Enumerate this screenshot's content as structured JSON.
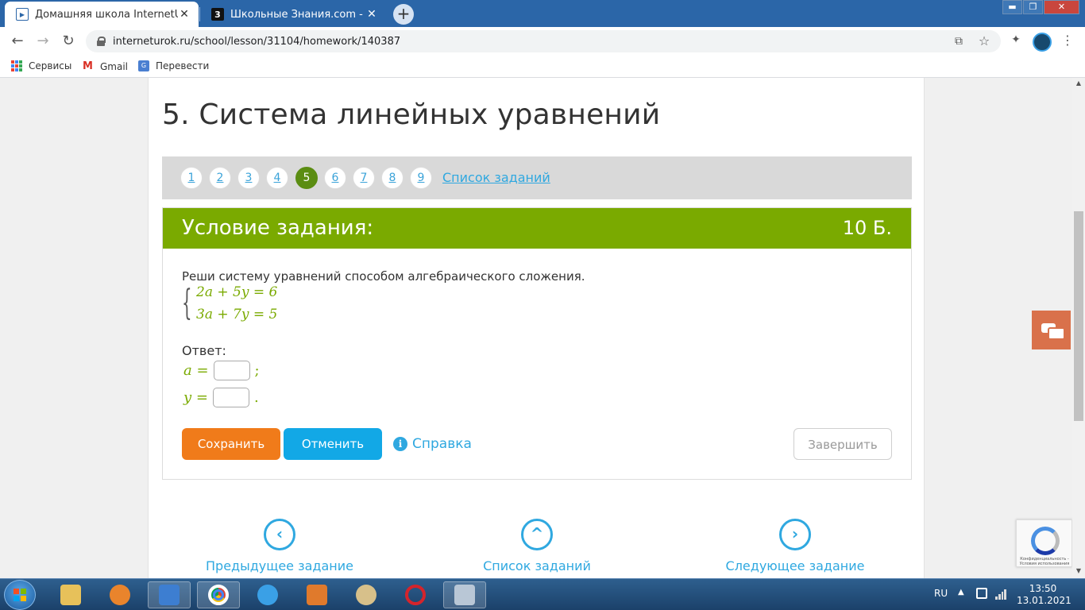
{
  "browser": {
    "tabs": [
      {
        "title": "Домашняя школа InternetUrok.ru",
        "close": "✕",
        "favicon": "play-icon"
      },
      {
        "title": "Школьные Знания.com - Решаем",
        "close": "✕",
        "favicon": "znanija-icon",
        "favicon_letter": "3"
      }
    ],
    "new_tab": "+",
    "window_controls": {
      "minimize": "▬",
      "maximize": "❐",
      "close": "✕"
    },
    "url": "interneturok.ru/school/lesson/31104/homework/140387",
    "bookmarks": [
      {
        "label": "Сервисы",
        "icon": "apps-icon"
      },
      {
        "label": "Gmail",
        "icon": "gmail-icon"
      },
      {
        "label": "Перевести",
        "icon": "translate-icon"
      }
    ],
    "gmail_glyph": "M",
    "translate_glyph": "G",
    "nav_glyphs": {
      "back": "←",
      "forward": "→",
      "reload": "↻",
      "open": "⧉",
      "star": "☆",
      "ext": "✦",
      "menu": "⋮"
    }
  },
  "lesson": {
    "title": "5. Система линейных уравнений",
    "pagination": [
      "1",
      "2",
      "3",
      "4",
      "5",
      "6",
      "7",
      "8",
      "9"
    ],
    "active_page": "5",
    "task_list_link": "Список заданий"
  },
  "task": {
    "heading": "Условие задания:",
    "points": "10 Б.",
    "text": "Реши систему уравнений способом алгебраического сложения.",
    "brace": "{",
    "equations": [
      "2a + 5y = 6",
      "3a + 7y = 5"
    ],
    "answer_label": "Ответ:",
    "answers": [
      {
        "var": "a =",
        "punct": ";",
        "value": ""
      },
      {
        "var": "y =",
        "punct": ".",
        "value": ""
      }
    ],
    "buttons": {
      "save": "Сохранить",
      "cancel": "Отменить",
      "help": "Справка",
      "finish": "Завершить"
    },
    "info_glyph": "i"
  },
  "bottom_nav": {
    "prev": "Предыдущее задание",
    "list": "Список заданий",
    "next": "Следующее задание",
    "prev_glyph": "‹",
    "list_glyph": "^",
    "next_glyph": "›"
  },
  "recaptcha": {
    "text": "Конфиденциальность - Условия использования"
  },
  "scroll_glyphs": {
    "up": "▲",
    "down": "▼"
  },
  "taskbar": {
    "apps": [
      "explorer-icon",
      "browser-icon",
      "media-player-icon",
      "chrome-icon",
      "ie-icon",
      "video-icon",
      "paint-icon",
      "opera-icon",
      "calculator-icon"
    ],
    "tray": {
      "lang": "RU",
      "up_arrow": "▲"
    },
    "clock": {
      "time": "13:50",
      "date": "13.01.2021"
    }
  },
  "colors": {
    "green_header": "#7aaa00",
    "active_page": "#5b8d12",
    "save": "#f07b1a",
    "cancel": "#12a8e6",
    "link": "#2fa8e0",
    "chat": "#d9714b"
  }
}
